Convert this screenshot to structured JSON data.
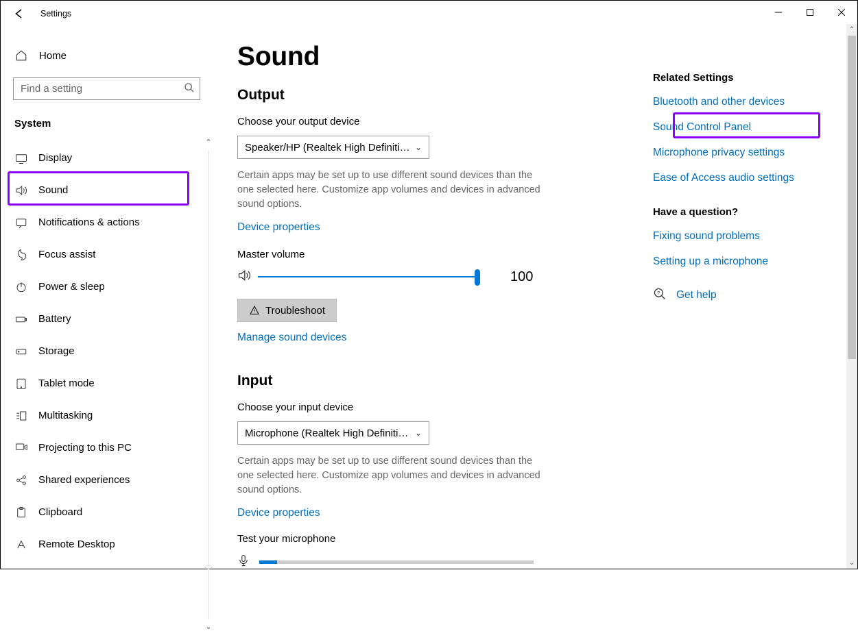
{
  "window": {
    "title": "Settings"
  },
  "sidebar": {
    "home": "Home",
    "search_placeholder": "Find a setting",
    "group": "System",
    "items": [
      {
        "label": "Display"
      },
      {
        "label": "Sound"
      },
      {
        "label": "Notifications & actions"
      },
      {
        "label": "Focus assist"
      },
      {
        "label": "Power & sleep"
      },
      {
        "label": "Battery"
      },
      {
        "label": "Storage"
      },
      {
        "label": "Tablet mode"
      },
      {
        "label": "Multitasking"
      },
      {
        "label": "Projecting to this PC"
      },
      {
        "label": "Shared experiences"
      },
      {
        "label": "Clipboard"
      },
      {
        "label": "Remote Desktop"
      }
    ]
  },
  "main": {
    "title": "Sound",
    "output": {
      "heading": "Output",
      "choose_label": "Choose your output device",
      "device": "Speaker/HP (Realtek High Definiti…",
      "info": "Certain apps may be set up to use different sound devices than the one selected here. Customize app volumes and devices in advanced sound options.",
      "device_props": "Device properties",
      "master_volume_label": "Master volume",
      "master_volume_value": "100",
      "troubleshoot": "Troubleshoot",
      "manage": "Manage sound devices"
    },
    "input": {
      "heading": "Input",
      "choose_label": "Choose your input device",
      "device": "Microphone (Realtek High Definiti…",
      "info": "Certain apps may be set up to use different sound devices than the one selected here. Customize app volumes and devices in advanced sound options.",
      "device_props": "Device properties",
      "test_label": "Test your microphone"
    }
  },
  "right": {
    "related_heading": "Related Settings",
    "related_links": {
      "bluetooth": "Bluetooth and other devices",
      "sound_panel": "Sound Control Panel",
      "mic_privacy": "Microphone privacy settings",
      "ease": "Ease of Access audio settings"
    },
    "question_heading": "Have a question?",
    "question_links": {
      "fixing": "Fixing sound problems",
      "mic_setup": "Setting up a microphone"
    },
    "get_help": "Get help"
  }
}
